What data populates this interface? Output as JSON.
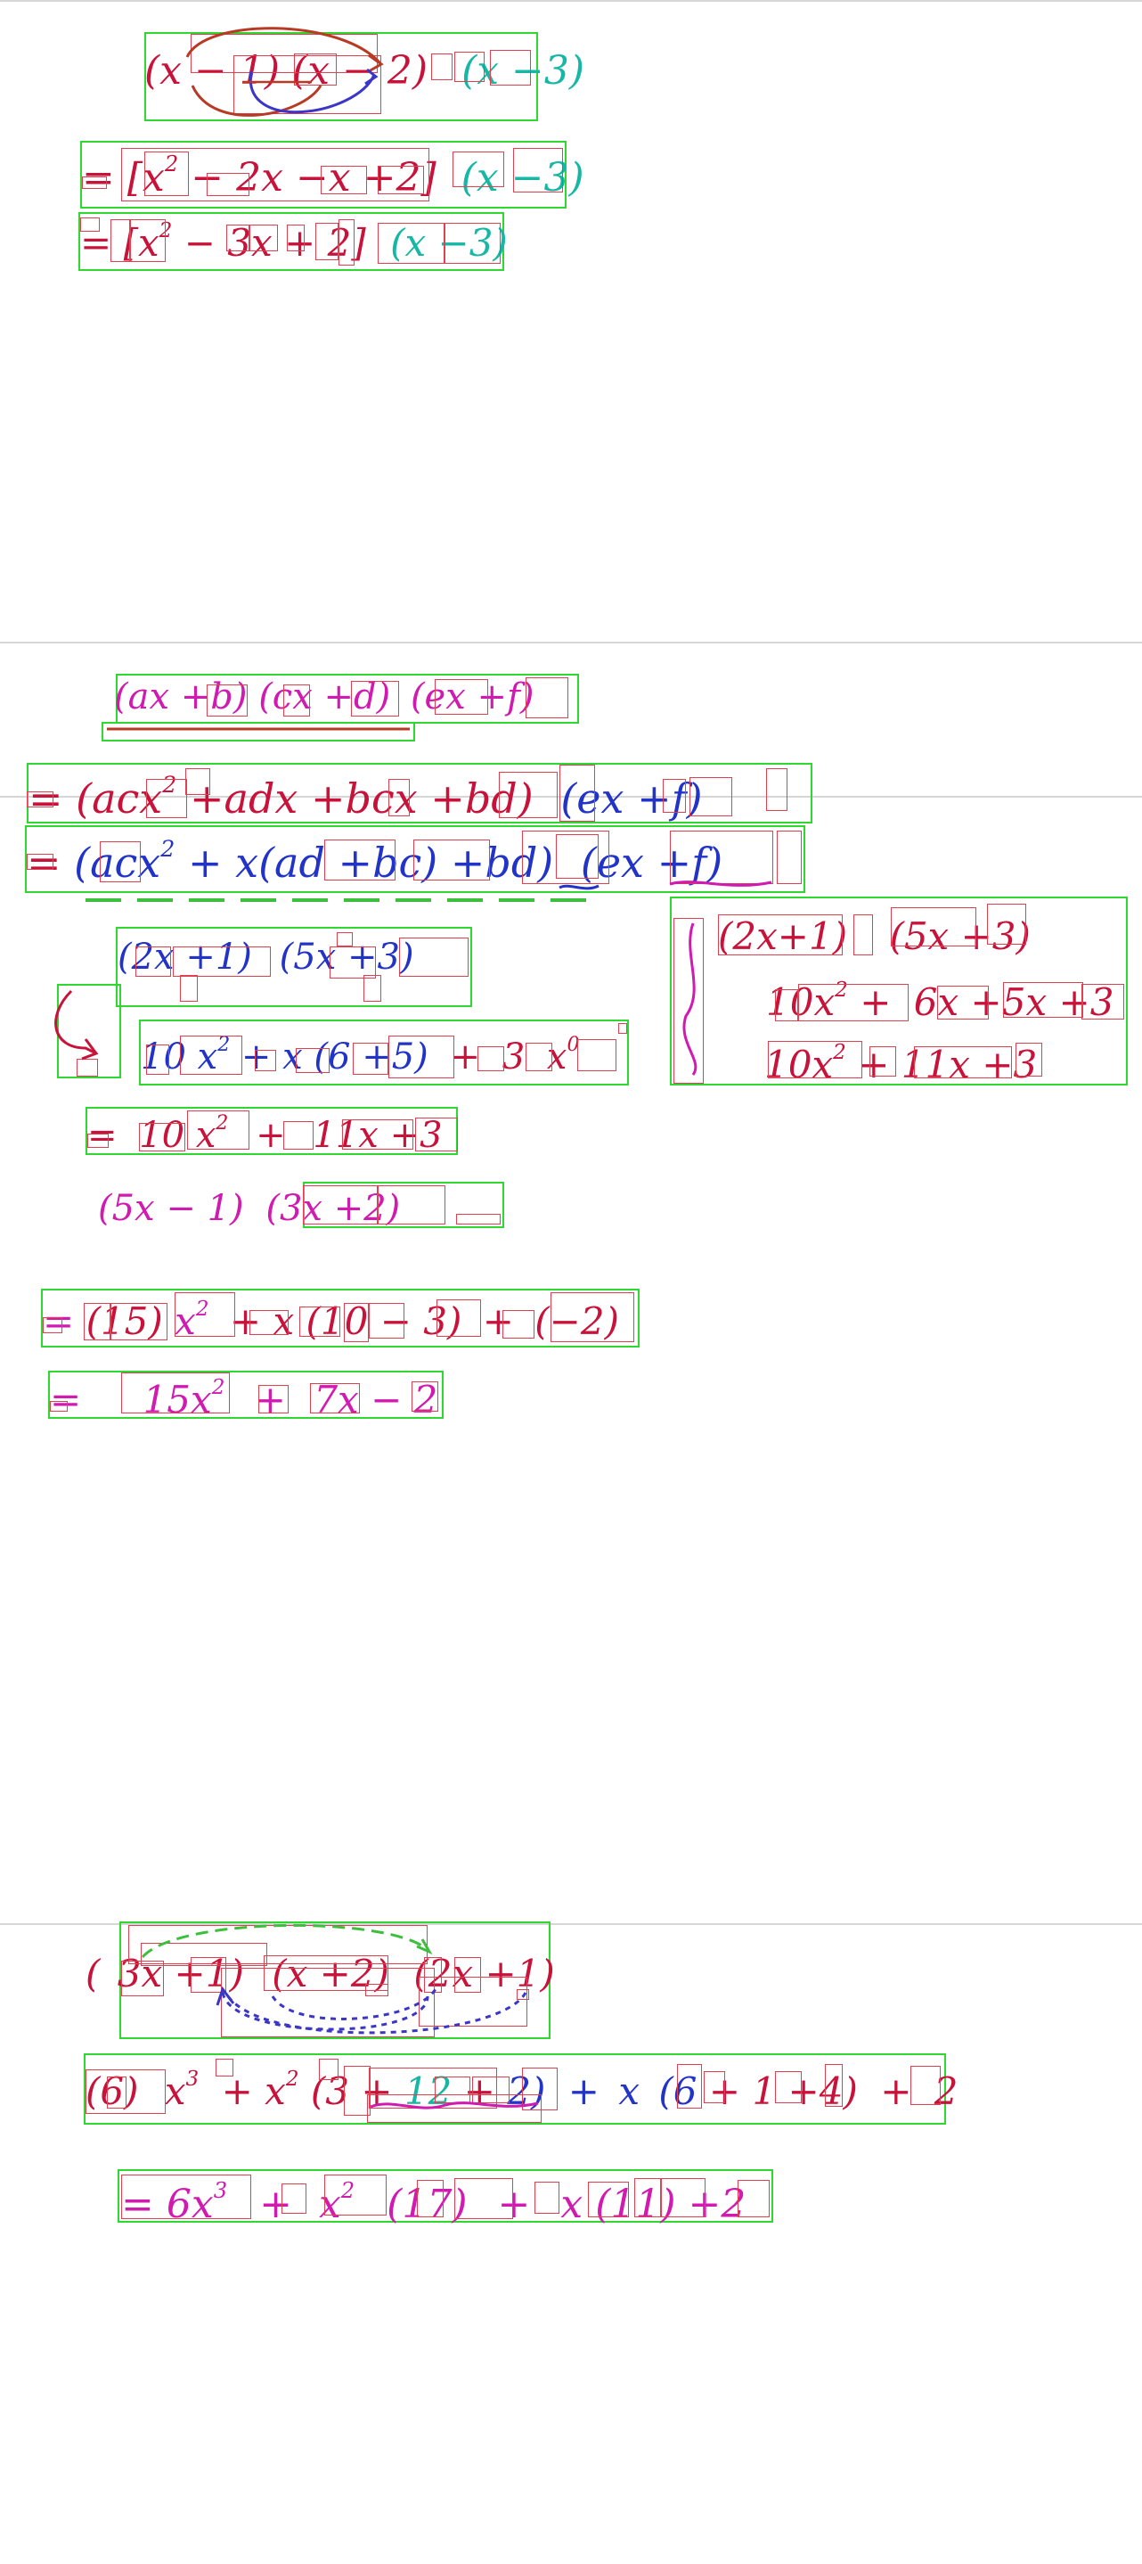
{
  "colors": {
    "crimson": "#c8123a",
    "magenta": "#d01ab0",
    "blue": "#2234c8",
    "teal": "#16b7a4",
    "frame": "#2ed82e",
    "subframe": "#e0404f",
    "arrow_red": "#b83a25",
    "arrow_blue": "#3a36c8",
    "arrow_green": "#3cbf3c"
  },
  "section1": {
    "line1": [
      "(x",
      "−",
      "1)",
      "(x",
      "−",
      "2)",
      "(x",
      "−3)"
    ],
    "line2": [
      "=",
      "[x",
      "2",
      "−",
      "2x",
      "−x",
      "+2]",
      "(x",
      "−3)"
    ],
    "line3": [
      "=",
      "[x",
      "2",
      "−",
      "3x",
      "+",
      "2]",
      "(x",
      "−3)"
    ]
  },
  "section2": {
    "line1": [
      "(ax",
      "+b)",
      "(cx",
      "+d)",
      "(ex",
      "+f)"
    ],
    "line2": [
      "=",
      "(acx",
      "2",
      "+adx",
      "+bcx",
      "+bd)",
      "(ex",
      "+f)"
    ],
    "line3": [
      "=",
      "(acx",
      "2",
      "+",
      "x(ad",
      "+bc)",
      "+bd)",
      "(ex",
      "+f)"
    ],
    "ex1_line1": [
      "(2x",
      "+1)",
      "(5x",
      "+3)"
    ],
    "ex1_line2": [
      "10",
      "x",
      "2",
      "+",
      "x",
      "(6",
      "+5)",
      "+",
      "3",
      "x",
      "0"
    ],
    "ex1_line3": [
      "=",
      "10",
      "x",
      "2",
      "+",
      "11x",
      "+3"
    ],
    "side_line1": [
      "(2x+1)",
      "(5x",
      "+3)"
    ],
    "side_line2": [
      "10x",
      "2",
      "+",
      "6x",
      "+5x",
      "+3"
    ],
    "side_line3": [
      "10x",
      "2",
      "+",
      "11x",
      "+3"
    ],
    "ex2_line1": [
      "(5x",
      "−",
      "1)",
      "(3x",
      "+2)"
    ],
    "ex2_line2": [
      "=",
      "(15)",
      "x",
      "2",
      "+",
      "x",
      "(10",
      "−",
      "3)",
      "+",
      "(−2)"
    ],
    "ex2_line3": [
      "=",
      "15x",
      "2",
      "+",
      "7x",
      "−",
      "2"
    ]
  },
  "section3": {
    "line1": [
      "(",
      "3x",
      "+1)",
      "(x",
      "+2)",
      "(2x",
      "+1)"
    ],
    "line2": [
      "(6)",
      "x",
      "3",
      "+",
      "x",
      "2",
      "(3",
      "+",
      "12",
      "+",
      "2)",
      "+",
      "x",
      "(6",
      "+",
      "1",
      "+4)",
      "+",
      "2"
    ],
    "line3": [
      "=",
      "6x",
      "3",
      "+",
      "x",
      "2",
      "(17)",
      "+",
      "x",
      "(11)",
      "+2"
    ]
  }
}
